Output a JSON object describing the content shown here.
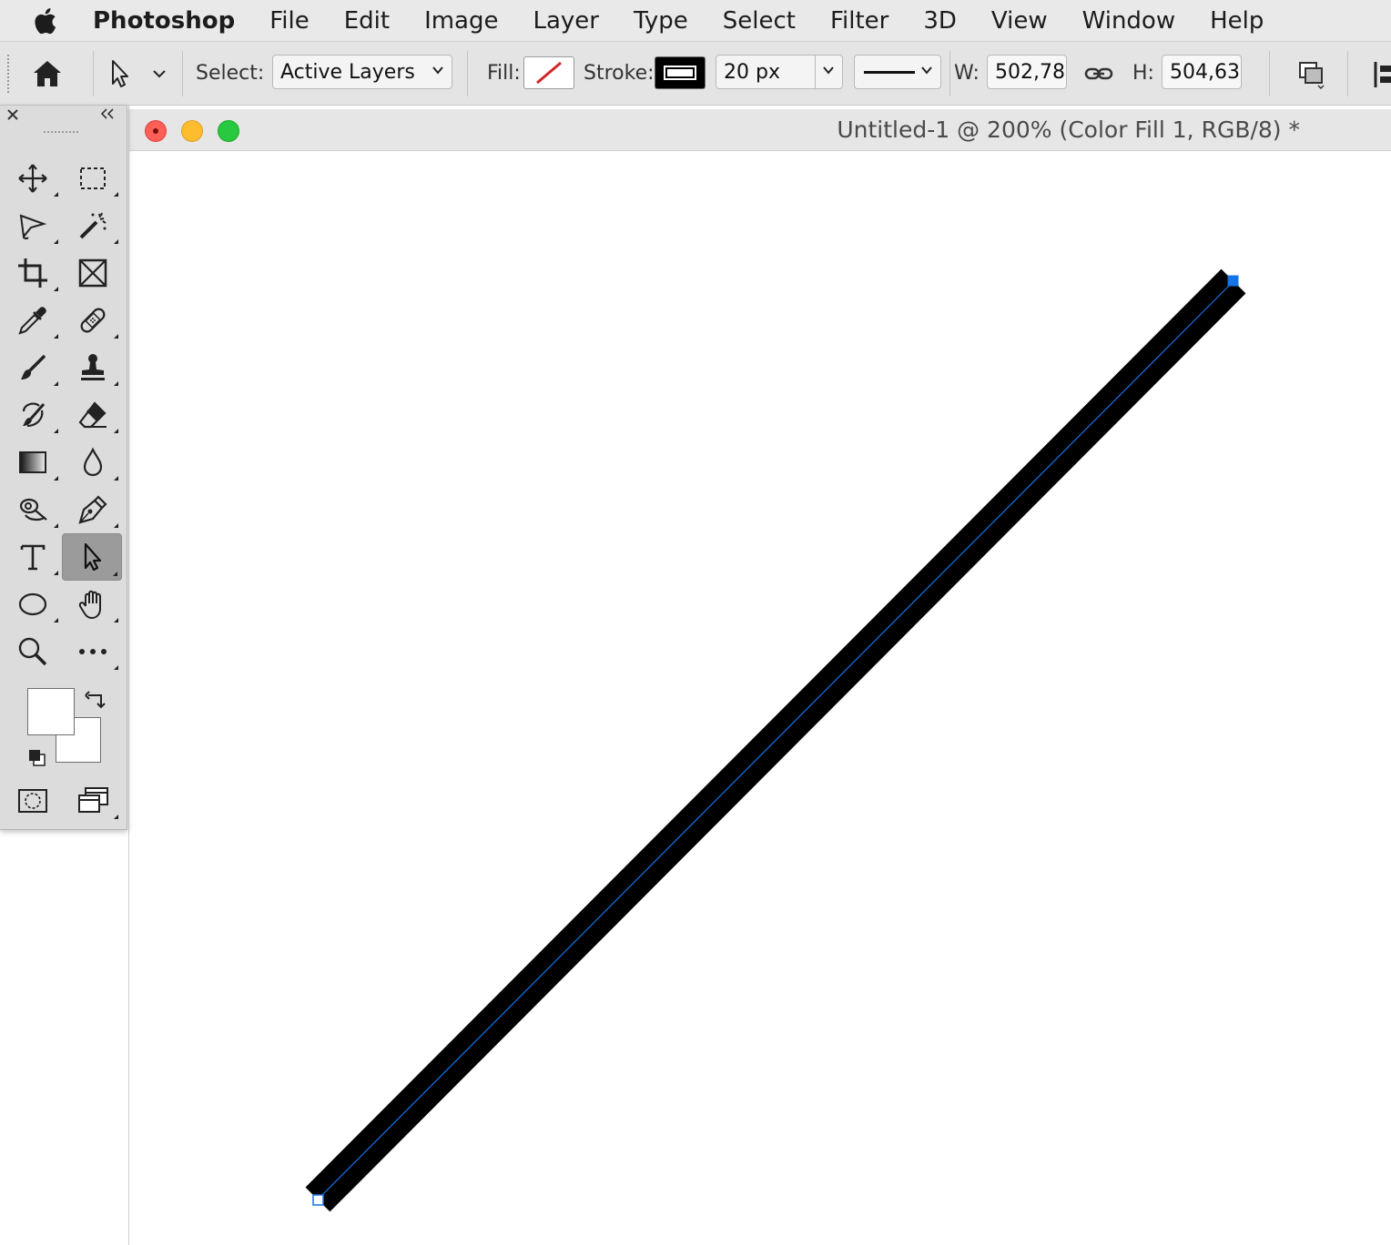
{
  "menubar": {
    "app_name": "Photoshop",
    "items": [
      "File",
      "Edit",
      "Image",
      "Layer",
      "Type",
      "Select",
      "Filter",
      "3D",
      "View",
      "Window",
      "Help"
    ]
  },
  "options": {
    "select_label": "Select:",
    "select_value": "Active Layers",
    "fill_label": "Fill:",
    "stroke_label": "Stroke:",
    "stroke_width": "20 px",
    "w_label": "W:",
    "w_value": "502,78",
    "h_label": "H:",
    "h_value": "504,63"
  },
  "document": {
    "title": "Untitled-1 @ 200% (Color Fill 1, RGB/8) *"
  },
  "tools": [
    {
      "name": "move-tool",
      "icon": "move-icon"
    },
    {
      "name": "rectangular-marquee-tool",
      "icon": "marquee-icon"
    },
    {
      "name": "lasso-tool",
      "icon": "lasso-icon"
    },
    {
      "name": "magic-wand-tool",
      "icon": "magic-wand-icon"
    },
    {
      "name": "crop-tool",
      "icon": "crop-icon"
    },
    {
      "name": "frame-tool",
      "icon": "frame-icon"
    },
    {
      "name": "eyedropper-tool",
      "icon": "eyedropper-icon"
    },
    {
      "name": "healing-brush-tool",
      "icon": "bandage-icon"
    },
    {
      "name": "brush-tool",
      "icon": "brush-icon"
    },
    {
      "name": "clone-stamp-tool",
      "icon": "stamp-icon"
    },
    {
      "name": "history-brush-tool",
      "icon": "history-brush-icon"
    },
    {
      "name": "eraser-tool",
      "icon": "eraser-icon"
    },
    {
      "name": "gradient-tool",
      "icon": "gradient-icon"
    },
    {
      "name": "blur-tool",
      "icon": "drop-icon"
    },
    {
      "name": "dodge-tool",
      "icon": "dodge-icon"
    },
    {
      "name": "pen-tool",
      "icon": "pen-icon"
    },
    {
      "name": "type-tool",
      "icon": "type-icon"
    },
    {
      "name": "direct-selection-tool",
      "icon": "arrow-icon",
      "active": true
    },
    {
      "name": "ellipse-tool",
      "icon": "ellipse-icon"
    },
    {
      "name": "hand-tool",
      "icon": "hand-icon"
    },
    {
      "name": "zoom-tool",
      "icon": "zoom-icon"
    },
    {
      "name": "more-tools",
      "icon": "ellipsis-icon"
    }
  ],
  "colors": {
    "foreground": "#ffffff",
    "background": "#ffffff",
    "stroke": "#000000",
    "path_highlight": "#1473e6"
  }
}
